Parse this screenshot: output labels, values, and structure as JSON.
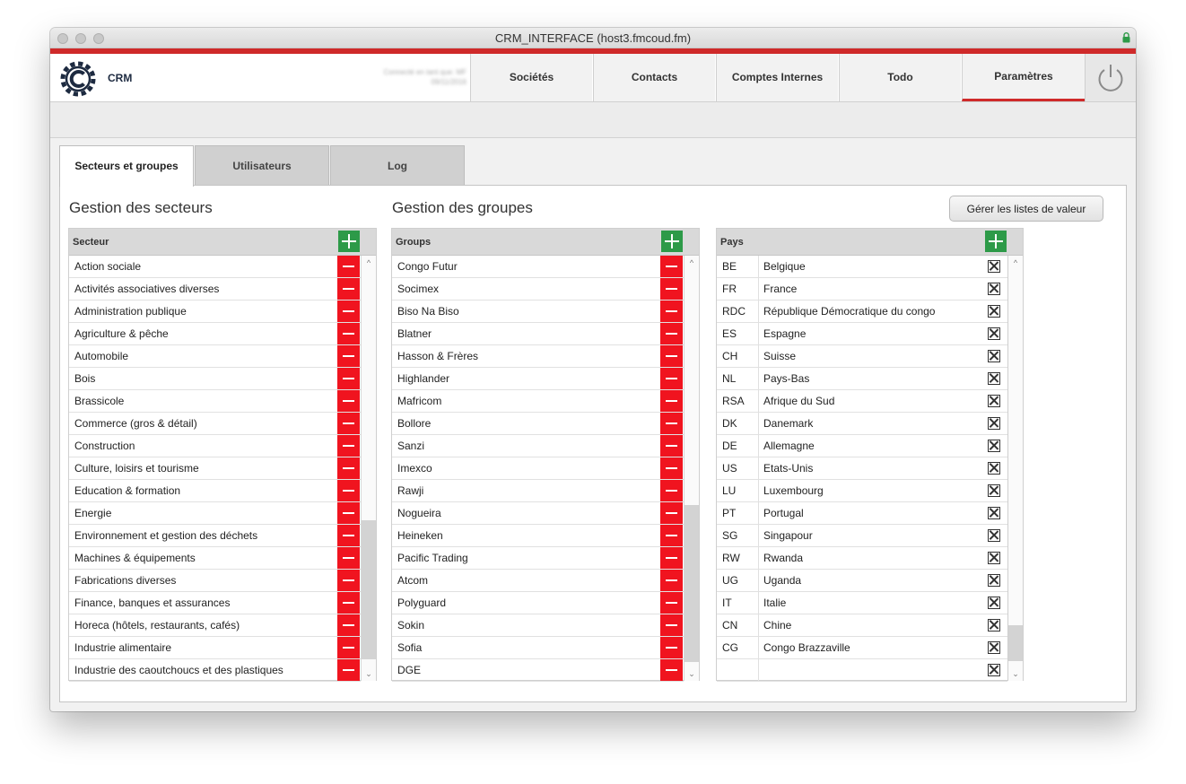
{
  "window": {
    "title": "CRM_INTERFACE (host3.fmcoud.fm)"
  },
  "header": {
    "brand": "CRM",
    "user_info_line1": "Connecté en tant que: MF",
    "user_info_line2": "09/11/2016",
    "nav": [
      "Sociétés",
      "Contacts",
      "Comptes Internes",
      "Todo",
      "Paramètres"
    ],
    "active_nav": "Paramètres"
  },
  "tabs": [
    "Secteurs et groupes",
    "Utilisateurs",
    "Log"
  ],
  "active_tab": "Secteurs et groupes",
  "secteurs": {
    "title": "Gestion des secteurs",
    "header": "Secteur",
    "items": [
      "Action sociale",
      "Activités associatives diverses",
      "Administration publique",
      "Agriculture & pêche",
      "Automobile",
      "Bois",
      "Brassicole",
      "Commerce (gros & détail)",
      "Construction",
      "Culture, loisirs et tourisme",
      "Education & formation",
      "Energie",
      "Environnement et gestion des déchets",
      "Machines & équipements",
      "Fabrications diverses",
      "Finance, banques et assurances",
      "Horeca (hôtels, restaurants, cafés)",
      "Industrie alimentaire",
      "Industrie des caoutchoucs et des plastiques"
    ]
  },
  "groupes": {
    "title": "Gestion des groupes",
    "header": "Groups",
    "items": [
      "Congo Futur",
      "Socimex",
      "Biso Na Biso",
      "Blatner",
      "Hasson & Frères",
      "Highlander",
      "Mafricom",
      "Bollore",
      "Sanzi",
      "Imexco",
      "Rawji",
      "Nogueira",
      "Heineken",
      "Pacific Trading",
      "Atcom",
      "Polyguard",
      "Sokin",
      "Sofia",
      "DGE"
    ]
  },
  "pays": {
    "header": "Pays",
    "button_label": "Gérer les listes de valeur",
    "items": [
      {
        "code": "BE",
        "name": "Belgique"
      },
      {
        "code": "FR",
        "name": "France"
      },
      {
        "code": "RDC",
        "name": "République Démocratique du congo"
      },
      {
        "code": "ES",
        "name": "Espagne"
      },
      {
        "code": "CH",
        "name": "Suisse"
      },
      {
        "code": "NL",
        "name": "Pays-Bas"
      },
      {
        "code": "RSA",
        "name": "Afrique du Sud"
      },
      {
        "code": "DK",
        "name": "Danemark"
      },
      {
        "code": "DE",
        "name": "Allemagne"
      },
      {
        "code": "US",
        "name": "Etats-Unis"
      },
      {
        "code": "LU",
        "name": "Luxembourg"
      },
      {
        "code": "PT",
        "name": "Portugal"
      },
      {
        "code": "SG",
        "name": "Singapour"
      },
      {
        "code": "RW",
        "name": "Rwanda"
      },
      {
        "code": "UG",
        "name": "Uganda"
      },
      {
        "code": "IT",
        "name": "Italie"
      },
      {
        "code": "CN",
        "name": "Chine"
      },
      {
        "code": "CG",
        "name": "Congo Brazzaville"
      },
      {
        "code": "",
        "name": ""
      }
    ]
  },
  "colors": {
    "accent_red": "#cf2a2a",
    "delete_red": "#f0141f",
    "add_green": "#2d9a48"
  }
}
